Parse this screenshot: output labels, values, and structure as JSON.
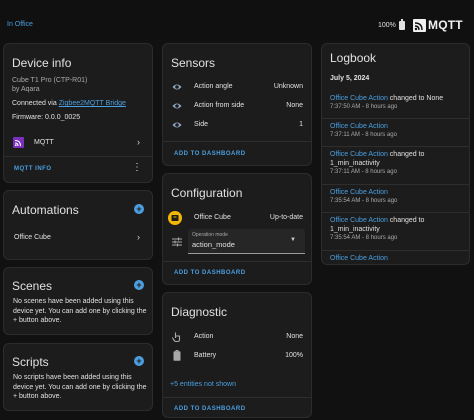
{
  "topbar": {
    "area": "In Office",
    "battery": "100%",
    "brand": "MQTT"
  },
  "device_info": {
    "title": "Device info",
    "model": "Cube T1 Pro (CTP-R01)",
    "manufacturer": "by Aqara",
    "connected_prefix": "Connected via ",
    "connected_link": "Zigbee2MQTT Bridge",
    "firmware": "Firmware: 0.0.0_0025",
    "integration": "MQTT",
    "action_button": "MQTT INFO"
  },
  "automations": {
    "title": "Automations",
    "item": "Office Cube"
  },
  "scenes": {
    "title": "Scenes",
    "empty": "No scenes have been added using this device yet. You can add one by clicking the + button above."
  },
  "scripts": {
    "title": "Scripts",
    "empty": "No scripts have been added using this device yet. You can add one by clicking the + button above."
  },
  "sensors": {
    "title": "Sensors",
    "rows": [
      {
        "label": "Action angle",
        "value": "Unknown"
      },
      {
        "label": "Action from side",
        "value": "None"
      },
      {
        "label": "Side",
        "value": "1"
      }
    ],
    "add_button": "ADD TO DASHBOARD"
  },
  "configuration": {
    "title": "Configuration",
    "update_label": "Office Cube",
    "update_value": "Up-to-date",
    "select_label": "Operation mode",
    "select_value": "action_mode",
    "add_button": "ADD TO DASHBOARD"
  },
  "diagnostic": {
    "title": "Diagnostic",
    "rows": [
      {
        "label": "Action",
        "value": "None"
      },
      {
        "label": "Battery",
        "value": "100%"
      }
    ],
    "hidden_link": "+5 entities not shown",
    "add_button": "ADD TO DASHBOARD"
  },
  "logbook": {
    "title": "Logbook",
    "date": "July 5, 2024",
    "entries": [
      {
        "name": "Office Cube Action",
        "msg1": " changed to None",
        "msg2": "",
        "time": "7:37:50 AM - 8 hours ago"
      },
      {
        "name": "Office Cube Action",
        "msg1": "",
        "msg2": "",
        "time": "7:37:11 AM - 8 hours ago"
      },
      {
        "name": "Office Cube Action",
        "msg1": " changed to",
        "msg2": "1_min_inactivity",
        "time": "7:37:11 AM - 8 hours ago"
      },
      {
        "name": "Office Cube Action",
        "msg1": "",
        "msg2": "",
        "time": "7:35:54 AM - 8 hours ago"
      },
      {
        "name": "Office Cube Action",
        "msg1": " changed to",
        "msg2": "1_min_inactivity",
        "time": "7:35:54 AM - 8 hours ago"
      },
      {
        "name": "Office Cube Action",
        "msg1": "",
        "msg2": "",
        "time": ""
      }
    ]
  },
  "colors": {
    "accent": "#4b9fe0",
    "card": "#1c1c1c",
    "background": "#111111",
    "update_badge": "#f2b705",
    "integration": "#7b2fbe"
  }
}
